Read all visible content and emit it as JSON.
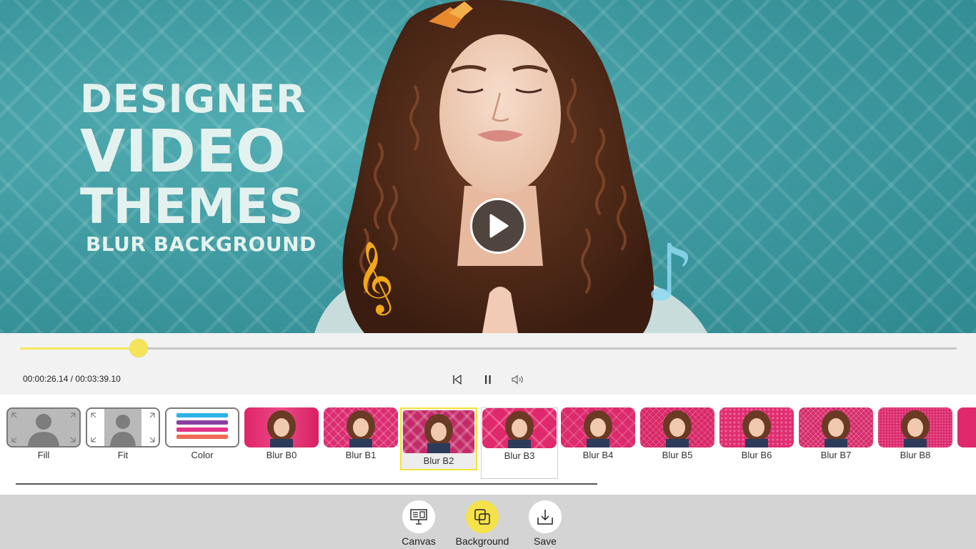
{
  "preview": {
    "headline": {
      "line1": "DESIGNER",
      "line2": "VIDEO",
      "line3": "THEMES",
      "line4": "BLUR BACKGROUND"
    },
    "music_note_left": "𝄞",
    "music_note_right": "♪",
    "play_icon": "play-icon"
  },
  "playback": {
    "progress_fraction": 0.127,
    "time": "00:00:26.14 / 00:03:39.10",
    "accent": "#f5e45a"
  },
  "backgrounds": {
    "items": [
      {
        "label": "Fill",
        "type": "fill"
      },
      {
        "label": "Fit",
        "type": "fit"
      },
      {
        "label": "Color",
        "type": "color"
      },
      {
        "label": "Blur B0",
        "type": "blur"
      },
      {
        "label": "Blur B1",
        "type": "blur"
      },
      {
        "label": "Blur B2",
        "type": "blur",
        "selected": true
      },
      {
        "label": "Blur B3",
        "type": "blur"
      },
      {
        "label": "Blur B4",
        "type": "blur"
      },
      {
        "label": "Blur B5",
        "type": "blur"
      },
      {
        "label": "Blur B6",
        "type": "blur"
      },
      {
        "label": "Blur B7",
        "type": "blur"
      },
      {
        "label": "Blur B8",
        "type": "blur"
      }
    ]
  },
  "toolbar": {
    "canvas_label": "Canvas",
    "background_label": "Background",
    "save_label": "Save",
    "active_color": "#f5e24a"
  }
}
